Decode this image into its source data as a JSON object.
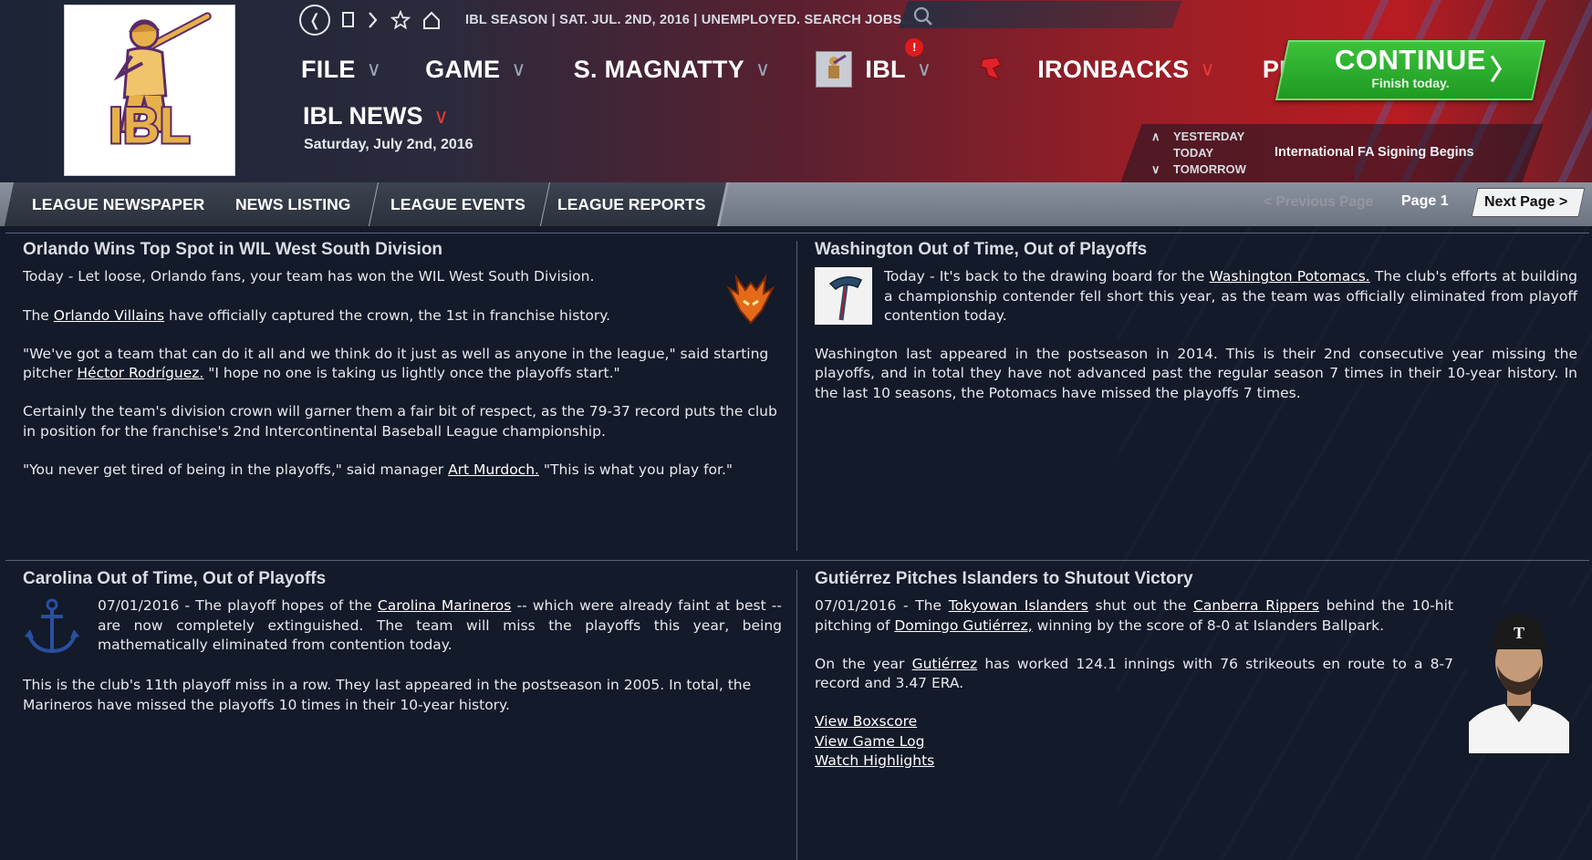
{
  "topbar": {
    "season_text": "IBL SEASON  |  SAT. JUL. 2ND, 2016  |  UNEMPLOYED. SEARCH JOBS..."
  },
  "menu": {
    "file": "FILE",
    "game": "GAME",
    "owner": "S. MAGNATTY",
    "league": "IBL",
    "league_badge": "!",
    "team": "IRONBACKS",
    "play": "PLAY"
  },
  "continue": {
    "label": "CONTINUE",
    "sub": "Finish today.",
    "arrow": "〉"
  },
  "page": {
    "title": "IBL NEWS",
    "date": "Saturday, July 2nd, 2016"
  },
  "days": {
    "yesterday": "YESTERDAY",
    "today": "TODAY",
    "tomorrow": "TOMORROW",
    "event": "International FA Signing Begins"
  },
  "tabs": [
    "LEAGUE NEWSPAPER",
    "NEWS LISTING",
    "LEAGUE EVENTS",
    "LEAGUE REPORTS"
  ],
  "paging": {
    "prev": "< Previous Page",
    "page": "Page 1",
    "next": "Next Page >"
  },
  "articles": {
    "a1": {
      "headline": "Orlando Wins Top Spot in WIL West South Division",
      "p1": "Today - Let loose, Orlando fans, your team has won the WIL West South Division.",
      "p2_pre": "The ",
      "p2_link": "Orlando Villains",
      "p2_post": " have officially captured the crown, the 1st in franchise history.",
      "p3_pre": "\"We've got a team that can do it all and we think do it just as well as anyone in the league,\" said starting pitcher ",
      "p3_link": "Héctor Rodríguez.",
      "p3_post": " \"I hope no one is taking us lightly once the playoffs start.\"",
      "p4": "Certainly the team's division crown will garner them a fair bit of respect, as the 79-37 record puts the club in position for the franchise's 2nd Intercontinental Baseball League championship.",
      "p5_pre": "\"You never get tired of being in the playoffs,\" said manager ",
      "p5_link": "Art Murdoch.",
      "p5_post": " \"This is what you play for.\""
    },
    "a2": {
      "headline": "Washington Out of Time, Out of Playoffs",
      "p1_pre": "Today - It's back to the drawing board for the ",
      "p1_link": "Washington Potomacs.",
      "p1_post": " The club's efforts at building a championship contender fell short this year, as the team was officially eliminated from playoff contention today.",
      "p2": "Washington last appeared in the postseason in 2014. This is their 2nd consecutive year missing the playoffs, and in total they have not advanced past the regular season 7 times in their 10-year history. In the last 10 seasons, the Potomacs have missed the playoffs 7 times."
    },
    "a3": {
      "headline": "Carolina Out of Time, Out of Playoffs",
      "p1_pre": "07/01/2016 - The playoff hopes of the ",
      "p1_link": "Carolina Marineros",
      "p1_post": " -- which were already faint at best -- are now completely extinguished. The team will miss the playoffs this year, being mathematically eliminated from contention today.",
      "p2": "This is the club's 11th playoff miss in a row. They last appeared in the postseason in 2005. In total, the Marineros have missed the playoffs 10 times in their 10-year history."
    },
    "a4": {
      "headline": "Gutiérrez Pitches Islanders to Shutout Victory",
      "p1_a": "07/01/2016 - The ",
      "p1_link1": "Tokyowan Islanders",
      "p1_b": " shut out the ",
      "p1_link2": "Canberra Rippers",
      "p1_c": " behind the 10-hit pitching of ",
      "p1_link3": "Domingo Gutiérrez,",
      "p1_d": " winning by the score of 8-0 at Islanders Ballpark.",
      "p2_a": "On the year ",
      "p2_link": "Gutiérrez",
      "p2_b": " has worked 124.1 innings with 76 strikeouts en route to a 8-7 record and 3.47 ERA.",
      "link_boxscore": "View Boxscore",
      "link_gamelog": "View Game Log",
      "link_highlights": "Watch Highlights"
    }
  }
}
